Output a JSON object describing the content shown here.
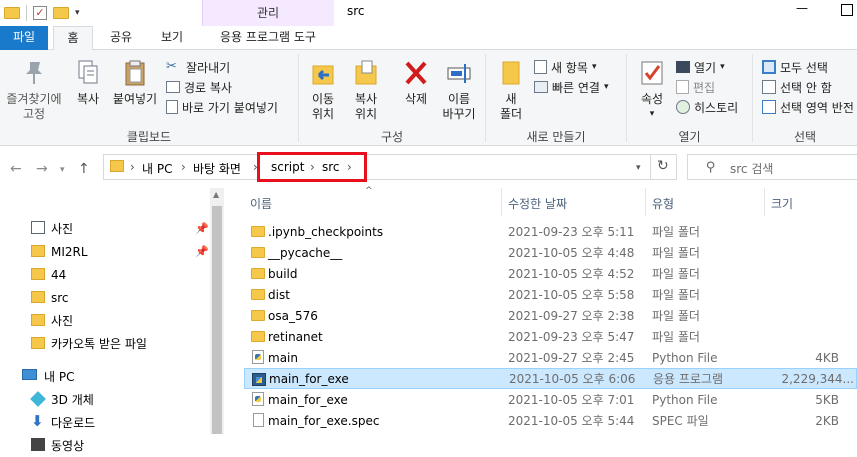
{
  "window": {
    "title": "src",
    "context_tab": "관리"
  },
  "tabs": [
    {
      "label": "파일"
    },
    {
      "label": "홈"
    },
    {
      "label": "공유"
    },
    {
      "label": "보기"
    },
    {
      "label": "응용 프로그램 도구"
    }
  ],
  "ribbon": {
    "clipboard": {
      "pin": "즐겨찾기에\n고정",
      "copy": "복사",
      "paste": "붙여넣기",
      "cut": "잘라내기",
      "copy_path": "경로 복사",
      "paste_shortcut": "바로 가기 붙여넣기",
      "label": "클립보드"
    },
    "organize": {
      "move_to": "이동\n위치",
      "copy_to": "복사\n위치",
      "delete": "삭제",
      "rename": "이름\n바꾸기",
      "label": "구성"
    },
    "new": {
      "new_folder": "새\n폴더",
      "new_item": "새 항목",
      "easy_access": "빠른 연결",
      "label": "새로 만들기"
    },
    "open": {
      "properties": "속성",
      "open": "열기",
      "edit": "편집",
      "history": "히스토리",
      "label": "열기"
    },
    "select": {
      "select_all": "모두 선택",
      "select_none": "선택 안 함",
      "invert": "선택 영역 반전",
      "label": "선택"
    }
  },
  "address": {
    "segments": [
      "내 PC",
      "바탕 화면",
      "script",
      "src"
    ],
    "search_placeholder": "src 검색"
  },
  "nav_pane": {
    "items": [
      {
        "label": "사진",
        "pinned": true
      },
      {
        "label": "MI2RL",
        "pinned": true
      },
      {
        "label": "44"
      },
      {
        "label": "src"
      },
      {
        "label": "사진"
      },
      {
        "label": "카카오톡 받은 파일"
      },
      {
        "label": "내 PC"
      },
      {
        "label": "3D 개체"
      },
      {
        "label": "다운로드"
      },
      {
        "label": "동영상"
      }
    ]
  },
  "columns": {
    "name": "이름",
    "date": "수정한 날짜",
    "type": "유형",
    "size": "크기"
  },
  "files": [
    {
      "name": ".ipynb_checkpoints",
      "date": "2021-09-23 오후 5:11",
      "type": "파일 폴더",
      "size": "",
      "icon": "folder-icon"
    },
    {
      "name": "__pycache__",
      "date": "2021-10-05 오후 4:48",
      "type": "파일 폴더",
      "size": "",
      "icon": "folder-icon"
    },
    {
      "name": "build",
      "date": "2021-10-05 오후 4:52",
      "type": "파일 폴더",
      "size": "",
      "icon": "folder-icon"
    },
    {
      "name": "dist",
      "date": "2021-10-05 오후 5:58",
      "type": "파일 폴더",
      "size": "",
      "icon": "folder-icon"
    },
    {
      "name": "osa_576",
      "date": "2021-09-27 오후 2:38",
      "type": "파일 폴더",
      "size": "",
      "icon": "folder-icon"
    },
    {
      "name": "retinanet",
      "date": "2021-09-23 오후 5:47",
      "type": "파일 폴더",
      "size": "",
      "icon": "folder-icon"
    },
    {
      "name": "main",
      "date": "2021-09-27 오후 2:45",
      "type": "Python File",
      "size": "4KB",
      "icon": "python-file-icon"
    },
    {
      "name": "main_for_exe",
      "date": "2021-10-05 오후 6:06",
      "type": "응용 프로그램",
      "size": "2,229,344...",
      "icon": "application-icon",
      "selected": true
    },
    {
      "name": "main_for_exe",
      "date": "2021-10-05 오후 7:01",
      "type": "Python File",
      "size": "5KB",
      "icon": "python-file-icon"
    },
    {
      "name": "main_for_exe.spec",
      "date": "2021-10-05 오후 5:44",
      "type": "SPEC 파일",
      "size": "2KB",
      "icon": "spec-file-icon"
    }
  ],
  "colors": {
    "file_tab": "#1979ca",
    "context_tab": "#f5e9ff",
    "selection": "#cce8ff",
    "highlight_box": "#e8101d",
    "folder": "#f5c84c"
  }
}
